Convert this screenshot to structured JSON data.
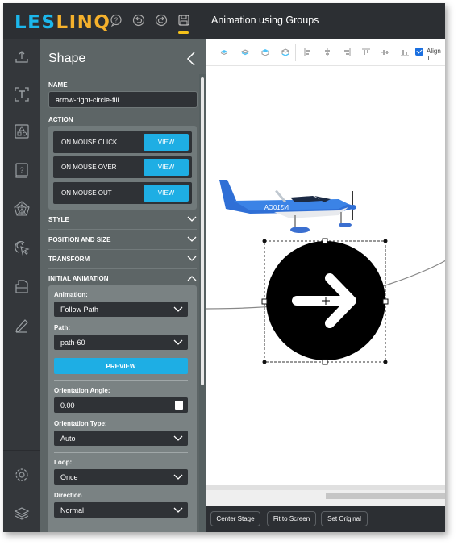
{
  "app": {
    "logo_part1": "LES",
    "logo_part2": "LINQ",
    "document_title": "Animation using Groups",
    "toolbar_icons": [
      "help-icon",
      "undo-icon",
      "redo-icon",
      "save-icon"
    ],
    "colors": {
      "brand_blue": "#1cb7ec",
      "brand_orange": "#f5b12c",
      "accent": "#1eaee4",
      "save_underline": "#f5c21a"
    }
  },
  "rail": {
    "items": [
      "upload-icon",
      "text-icon",
      "shapes-icon",
      "question-icon",
      "web-chart-icon",
      "click-target-icon",
      "folder-icon",
      "pencil-icon",
      "settings-icon",
      "layers-icon"
    ]
  },
  "panel": {
    "title": "Shape",
    "name_label": "NAME",
    "name_value": "arrow-right-circle-fill",
    "action_label": "ACTION",
    "actions": [
      {
        "label": "ON MOUSE CLICK",
        "button": "VIEW"
      },
      {
        "label": "ON MOUSE OVER",
        "button": "VIEW"
      },
      {
        "label": "ON MOUSE OUT",
        "button": "VIEW"
      }
    ],
    "sections": [
      {
        "label": "STYLE",
        "expanded": false
      },
      {
        "label": "POSITION AND SIZE",
        "expanded": false
      },
      {
        "label": "TRANSFORM",
        "expanded": false
      },
      {
        "label": "INITIAL ANIMATION",
        "expanded": true
      }
    ],
    "animation": {
      "animation_label": "Animation:",
      "animation_value": "Follow Path",
      "path_label": "Path:",
      "path_value": "path-60",
      "preview_label": "PREVIEW",
      "orientation_angle_label": "Orientation Angle:",
      "orientation_angle_value": "0.00",
      "orientation_type_label": "Orientation Type:",
      "orientation_type_value": "Auto",
      "loop_label": "Loop:",
      "loop_value": "Once",
      "direction_label": "Direction",
      "direction_value": "Normal"
    }
  },
  "canvas": {
    "toolbar": {
      "layer_icons": [
        "bring-forward-icon",
        "send-backward-icon",
        "bring-to-front-icon",
        "send-to-back-icon"
      ],
      "align_icons": [
        "align-left-icon",
        "align-center-icon",
        "align-right-icon",
        "align-top-icon",
        "align-middle-icon",
        "align-bottom-icon"
      ],
      "align_checkbox_checked": true,
      "align_label": "Align T"
    },
    "stage": {
      "image_label": "airplane",
      "aircraft_tail": "N310CA",
      "selected_shape": "arrow-right-circle-fill"
    }
  },
  "bottom": {
    "buttons": [
      "Center Stage",
      "Fit to Screen",
      "Set Original"
    ]
  }
}
